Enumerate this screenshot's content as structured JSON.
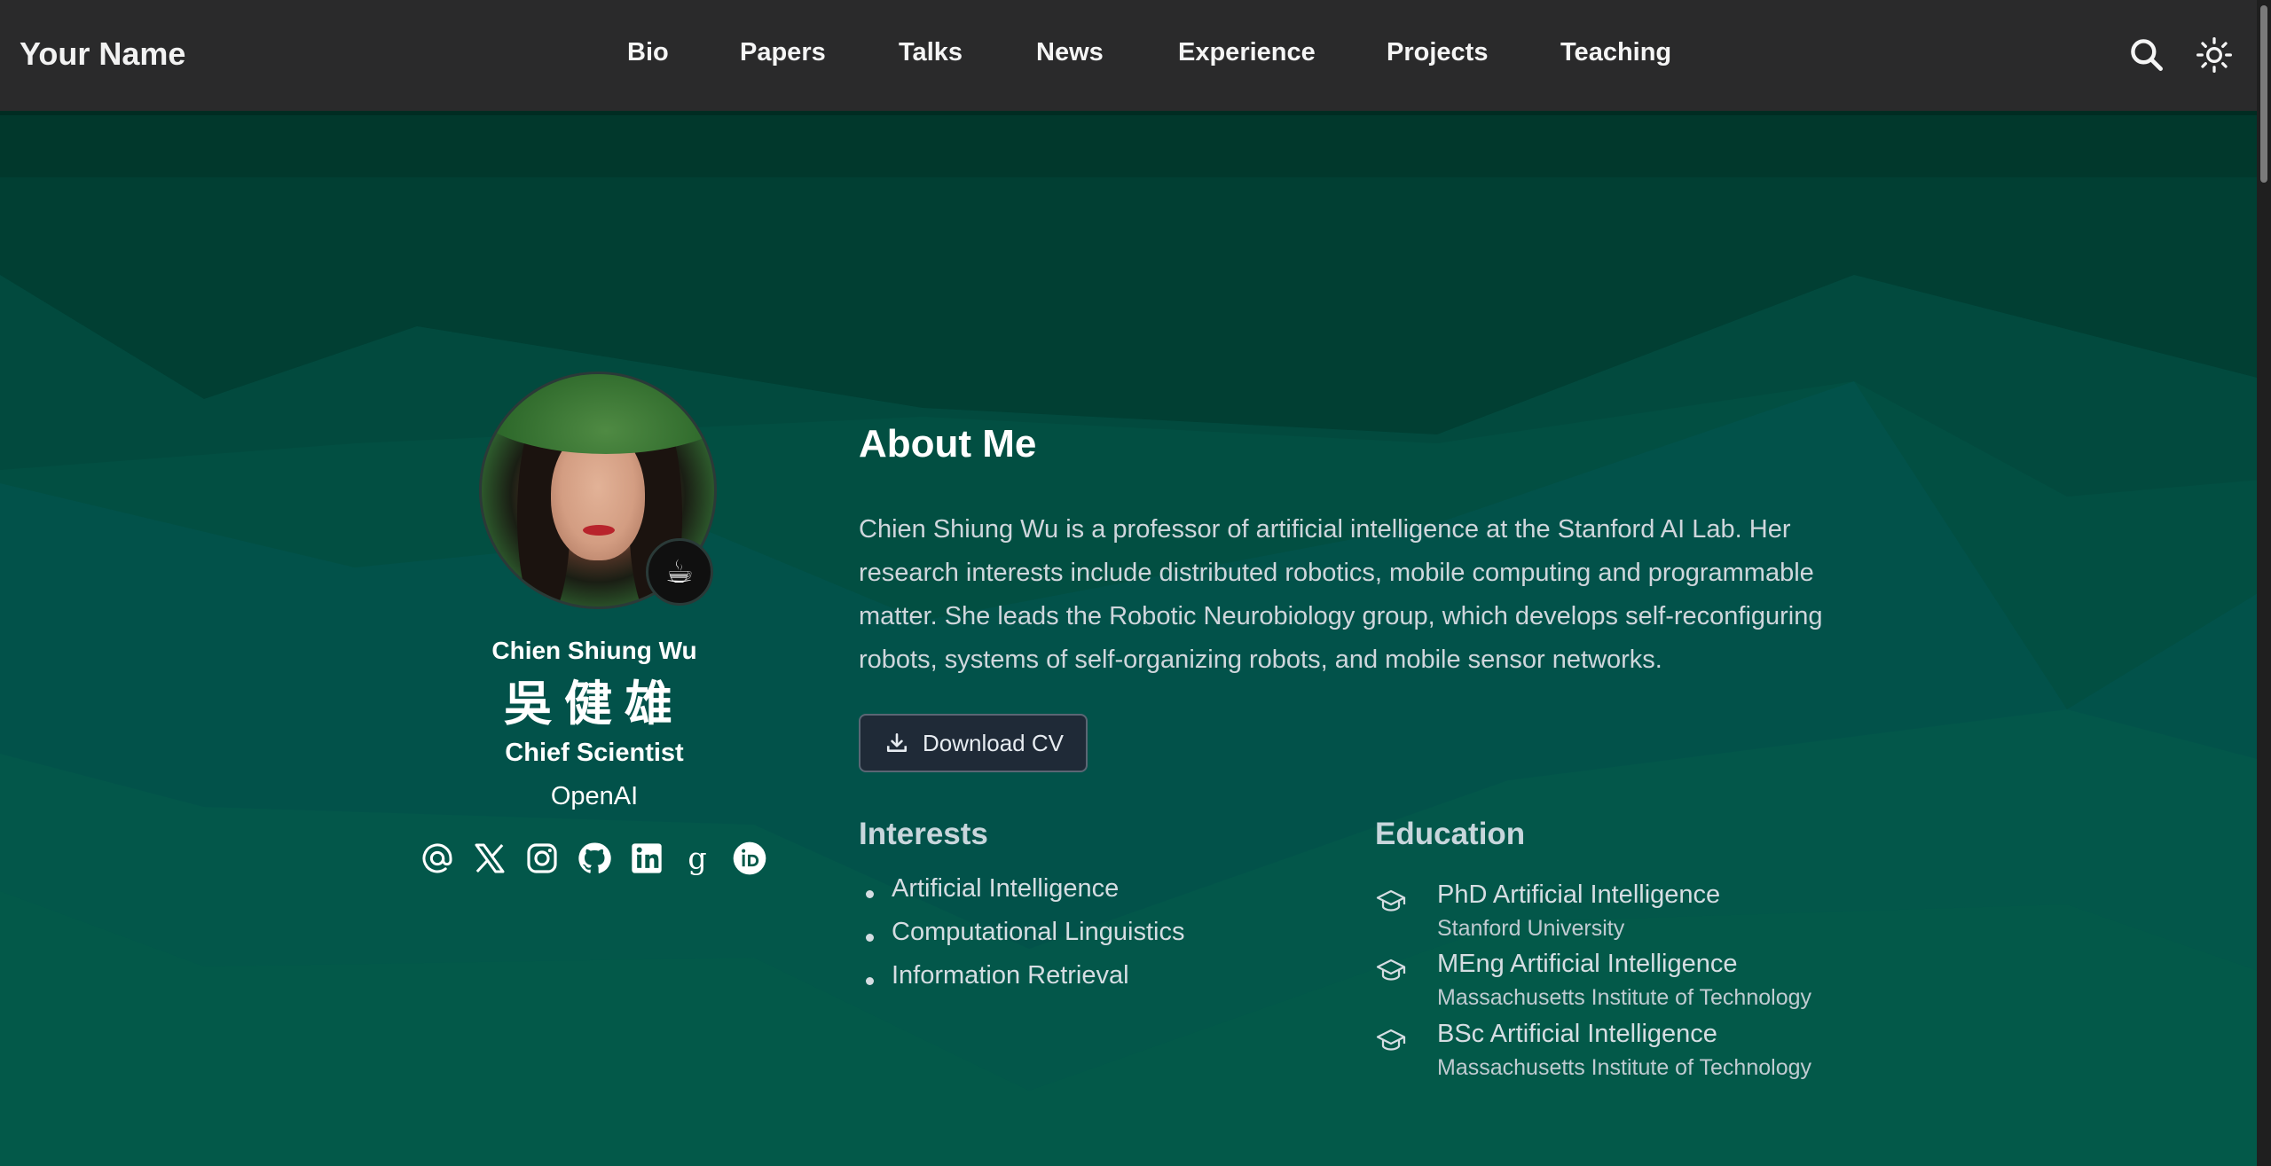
{
  "navbar": {
    "brand": "Your Name",
    "links": [
      "Bio",
      "Papers",
      "Talks",
      "News",
      "Experience",
      "Projects",
      "Teaching"
    ],
    "icons": [
      "search-icon",
      "sun-icon"
    ]
  },
  "profile": {
    "name": "Chien Shiung Wu",
    "name_cjk": "吳健雄",
    "role": "Chief Scientist",
    "organization": "OpenAI",
    "badge_emoji": "☕",
    "social_icons": [
      "at-icon",
      "x-icon",
      "instagram-icon",
      "github-icon",
      "linkedin-icon",
      "google-scholar-icon",
      "orcid-icon"
    ]
  },
  "about": {
    "title": "About Me",
    "bio_lines": [
      "Chien Shiung Wu is a professor of artificial intelligence at the Stanford AI Lab. Her",
      "research interests include distributed robotics, mobile computing and programmable",
      "matter. She leads the Robotic Neurobiology group, which develops self-reconfiguring",
      "robots, systems of self-organizing robots, and mobile sensor networks."
    ],
    "cv_button": "Download CV"
  },
  "interests": {
    "title": "Interests",
    "items": [
      "Artificial Intelligence",
      "Computational Linguistics",
      "Information Retrieval"
    ]
  },
  "education": {
    "title": "Education",
    "items": [
      {
        "degree": "PhD Artificial Intelligence",
        "school": "Stanford University"
      },
      {
        "degree": "MEng Artificial Intelligence",
        "school": "Massachusetts Institute of Technology"
      },
      {
        "degree": "BSc Artificial Intelligence",
        "school": "Massachusetts Institute of Technology"
      }
    ]
  },
  "colors": {
    "navbar": "#2a2a2b",
    "background_top": "#002a20",
    "background_bottom": "#035949",
    "button_bg": "#1f2a37"
  }
}
